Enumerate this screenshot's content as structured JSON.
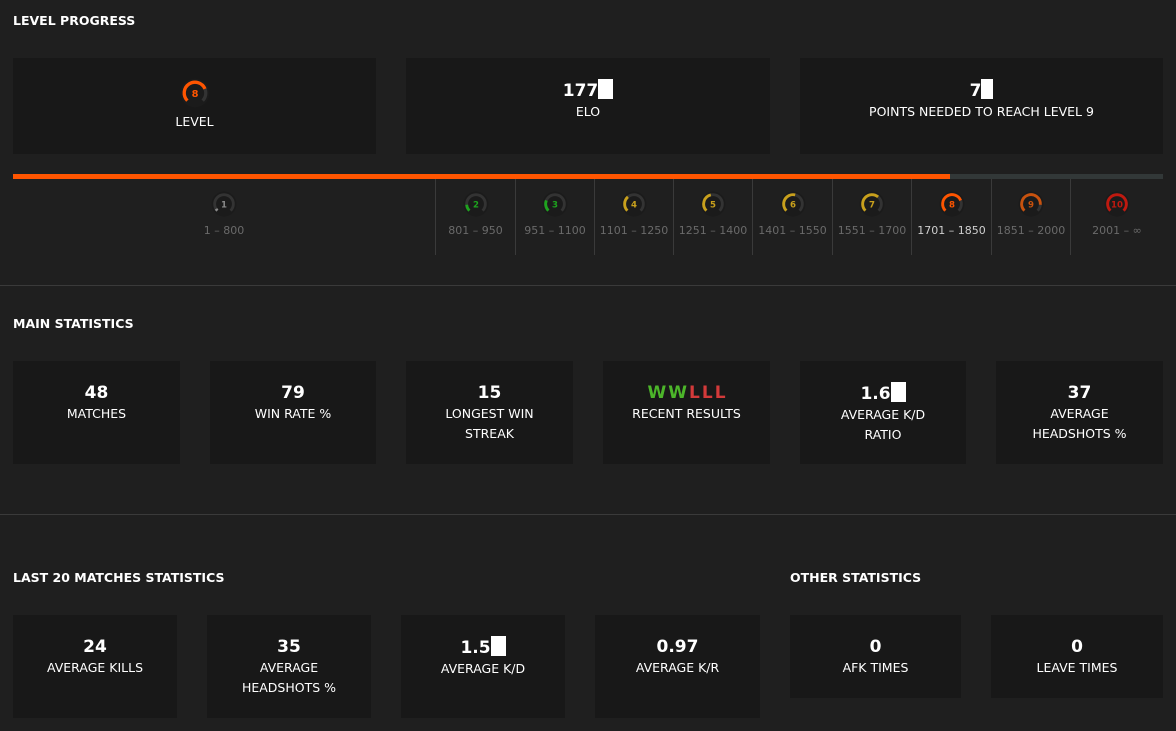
{
  "level_progress": {
    "title": "LEVEL PROGRESS",
    "current_level": {
      "value": "8",
      "label": "LEVEL",
      "color": "#ff5500"
    },
    "elo": {
      "value": "177",
      "label": "ELO"
    },
    "points_needed": {
      "value": "7",
      "label": "POINTS NEEDED TO REACH LEVEL 9"
    },
    "progress_fraction": 0.815,
    "levels": [
      {
        "level": "1",
        "range": "1 – 800",
        "color": "#8a8a8a",
        "fill": 0.05
      },
      {
        "level": "2",
        "range": "801 – 950",
        "color": "#1ea31e",
        "fill": 0.15
      },
      {
        "level": "3",
        "range": "951 – 1100",
        "color": "#1ea31e",
        "fill": 0.25
      },
      {
        "level": "4",
        "range": "1101 – 1250",
        "color": "#c8a01c",
        "fill": 0.35
      },
      {
        "level": "5",
        "range": "1251 – 1400",
        "color": "#c8a01c",
        "fill": 0.45
      },
      {
        "level": "6",
        "range": "1401 – 1550",
        "color": "#c8a01c",
        "fill": 0.55
      },
      {
        "level": "7",
        "range": "1551 – 1700",
        "color": "#c8a01c",
        "fill": 0.65
      },
      {
        "level": "8",
        "range": "1701 – 1850",
        "color": "#ff5500",
        "fill": 0.75
      },
      {
        "level": "9",
        "range": "1851 – 2000",
        "color": "#c8520e",
        "fill": 0.85
      },
      {
        "level": "10",
        "range": "2001 – ∞",
        "color": "#c0190f",
        "fill": 1.0
      }
    ]
  },
  "main_statistics": {
    "title": "MAIN STATISTICS",
    "cards": [
      {
        "value": "48",
        "label": "MATCHES"
      },
      {
        "value": "79",
        "label": "WIN RATE %"
      },
      {
        "value": "15",
        "label": "LONGEST WIN STREAK"
      },
      {
        "label": "RECENT RESULTS",
        "results": [
          "W",
          "W",
          "L",
          "L",
          "L"
        ]
      },
      {
        "value": "1.6",
        "label": "AVERAGE K/D RATIO"
      },
      {
        "value": "37",
        "label": "AVERAGE HEADSHOTS %"
      }
    ],
    "win_color": "#4cb52a",
    "loss_color": "#d33a3a"
  },
  "last20": {
    "title": "LAST 20 MATCHES STATISTICS",
    "cards": [
      {
        "value": "24",
        "label": "AVERAGE KILLS"
      },
      {
        "value": "35",
        "label": "AVERAGE HEADSHOTS %"
      },
      {
        "value": "1.5",
        "label": "AVERAGE K/D"
      },
      {
        "value": "0.97",
        "label": "AVERAGE K/R"
      }
    ]
  },
  "other": {
    "title": "OTHER STATISTICS",
    "cards": [
      {
        "value": "0",
        "label": "AFK TIMES"
      },
      {
        "value": "0",
        "label": "LEAVE TIMES"
      }
    ]
  }
}
